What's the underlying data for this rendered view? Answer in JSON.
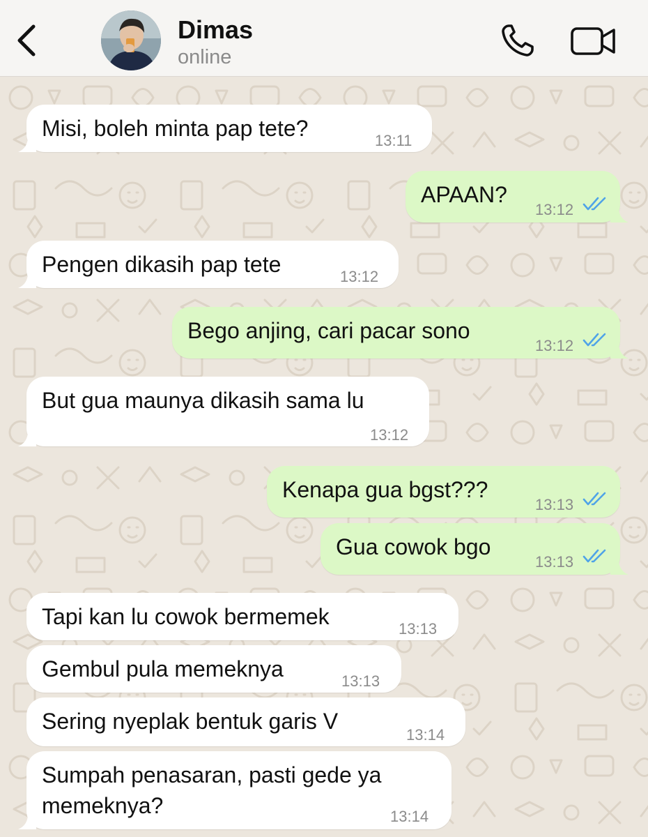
{
  "header": {
    "contact_name": "Dimas",
    "contact_status": "online",
    "back_icon": "chevron-left-icon",
    "call_icon": "phone-icon",
    "video_icon": "video-camera-icon"
  },
  "colors": {
    "incoming_bubble": "#ffffff",
    "outgoing_bubble": "#dcf8c6",
    "read_receipt": "#4fa3e8",
    "header_bg": "#f6f5f3",
    "chat_bg": "#ece6dd"
  },
  "messages": [
    {
      "direction": "in",
      "text": "Misi, boleh minta pap tete?",
      "time": "13:11"
    },
    {
      "direction": "out",
      "text": "APAAN?",
      "time": "13:12",
      "read": true
    },
    {
      "direction": "in",
      "text": "Pengen dikasih pap tete",
      "time": "13:12"
    },
    {
      "direction": "out",
      "text": "Bego anjing, cari pacar sono",
      "time": "13:12",
      "read": true
    },
    {
      "direction": "in",
      "text": "But gua maunya dikasih sama lu",
      "time": "13:12"
    },
    {
      "direction": "out",
      "text": "Kenapa gua bgst???",
      "time": "13:13",
      "read": true
    },
    {
      "direction": "out",
      "text": "Gua cowok bgo",
      "time": "13:13",
      "read": true
    },
    {
      "direction": "in",
      "text": "Tapi kan lu cowok bermemek",
      "time": "13:13"
    },
    {
      "direction": "in",
      "text": "Gembul pula memeknya",
      "time": "13:13"
    },
    {
      "direction": "in",
      "text": "Sering nyeplak bentuk garis V",
      "time": "13:14"
    },
    {
      "direction": "in",
      "text": "Sumpah penasaran, pasti gede ya memeknya?",
      "time": "13:14"
    }
  ]
}
